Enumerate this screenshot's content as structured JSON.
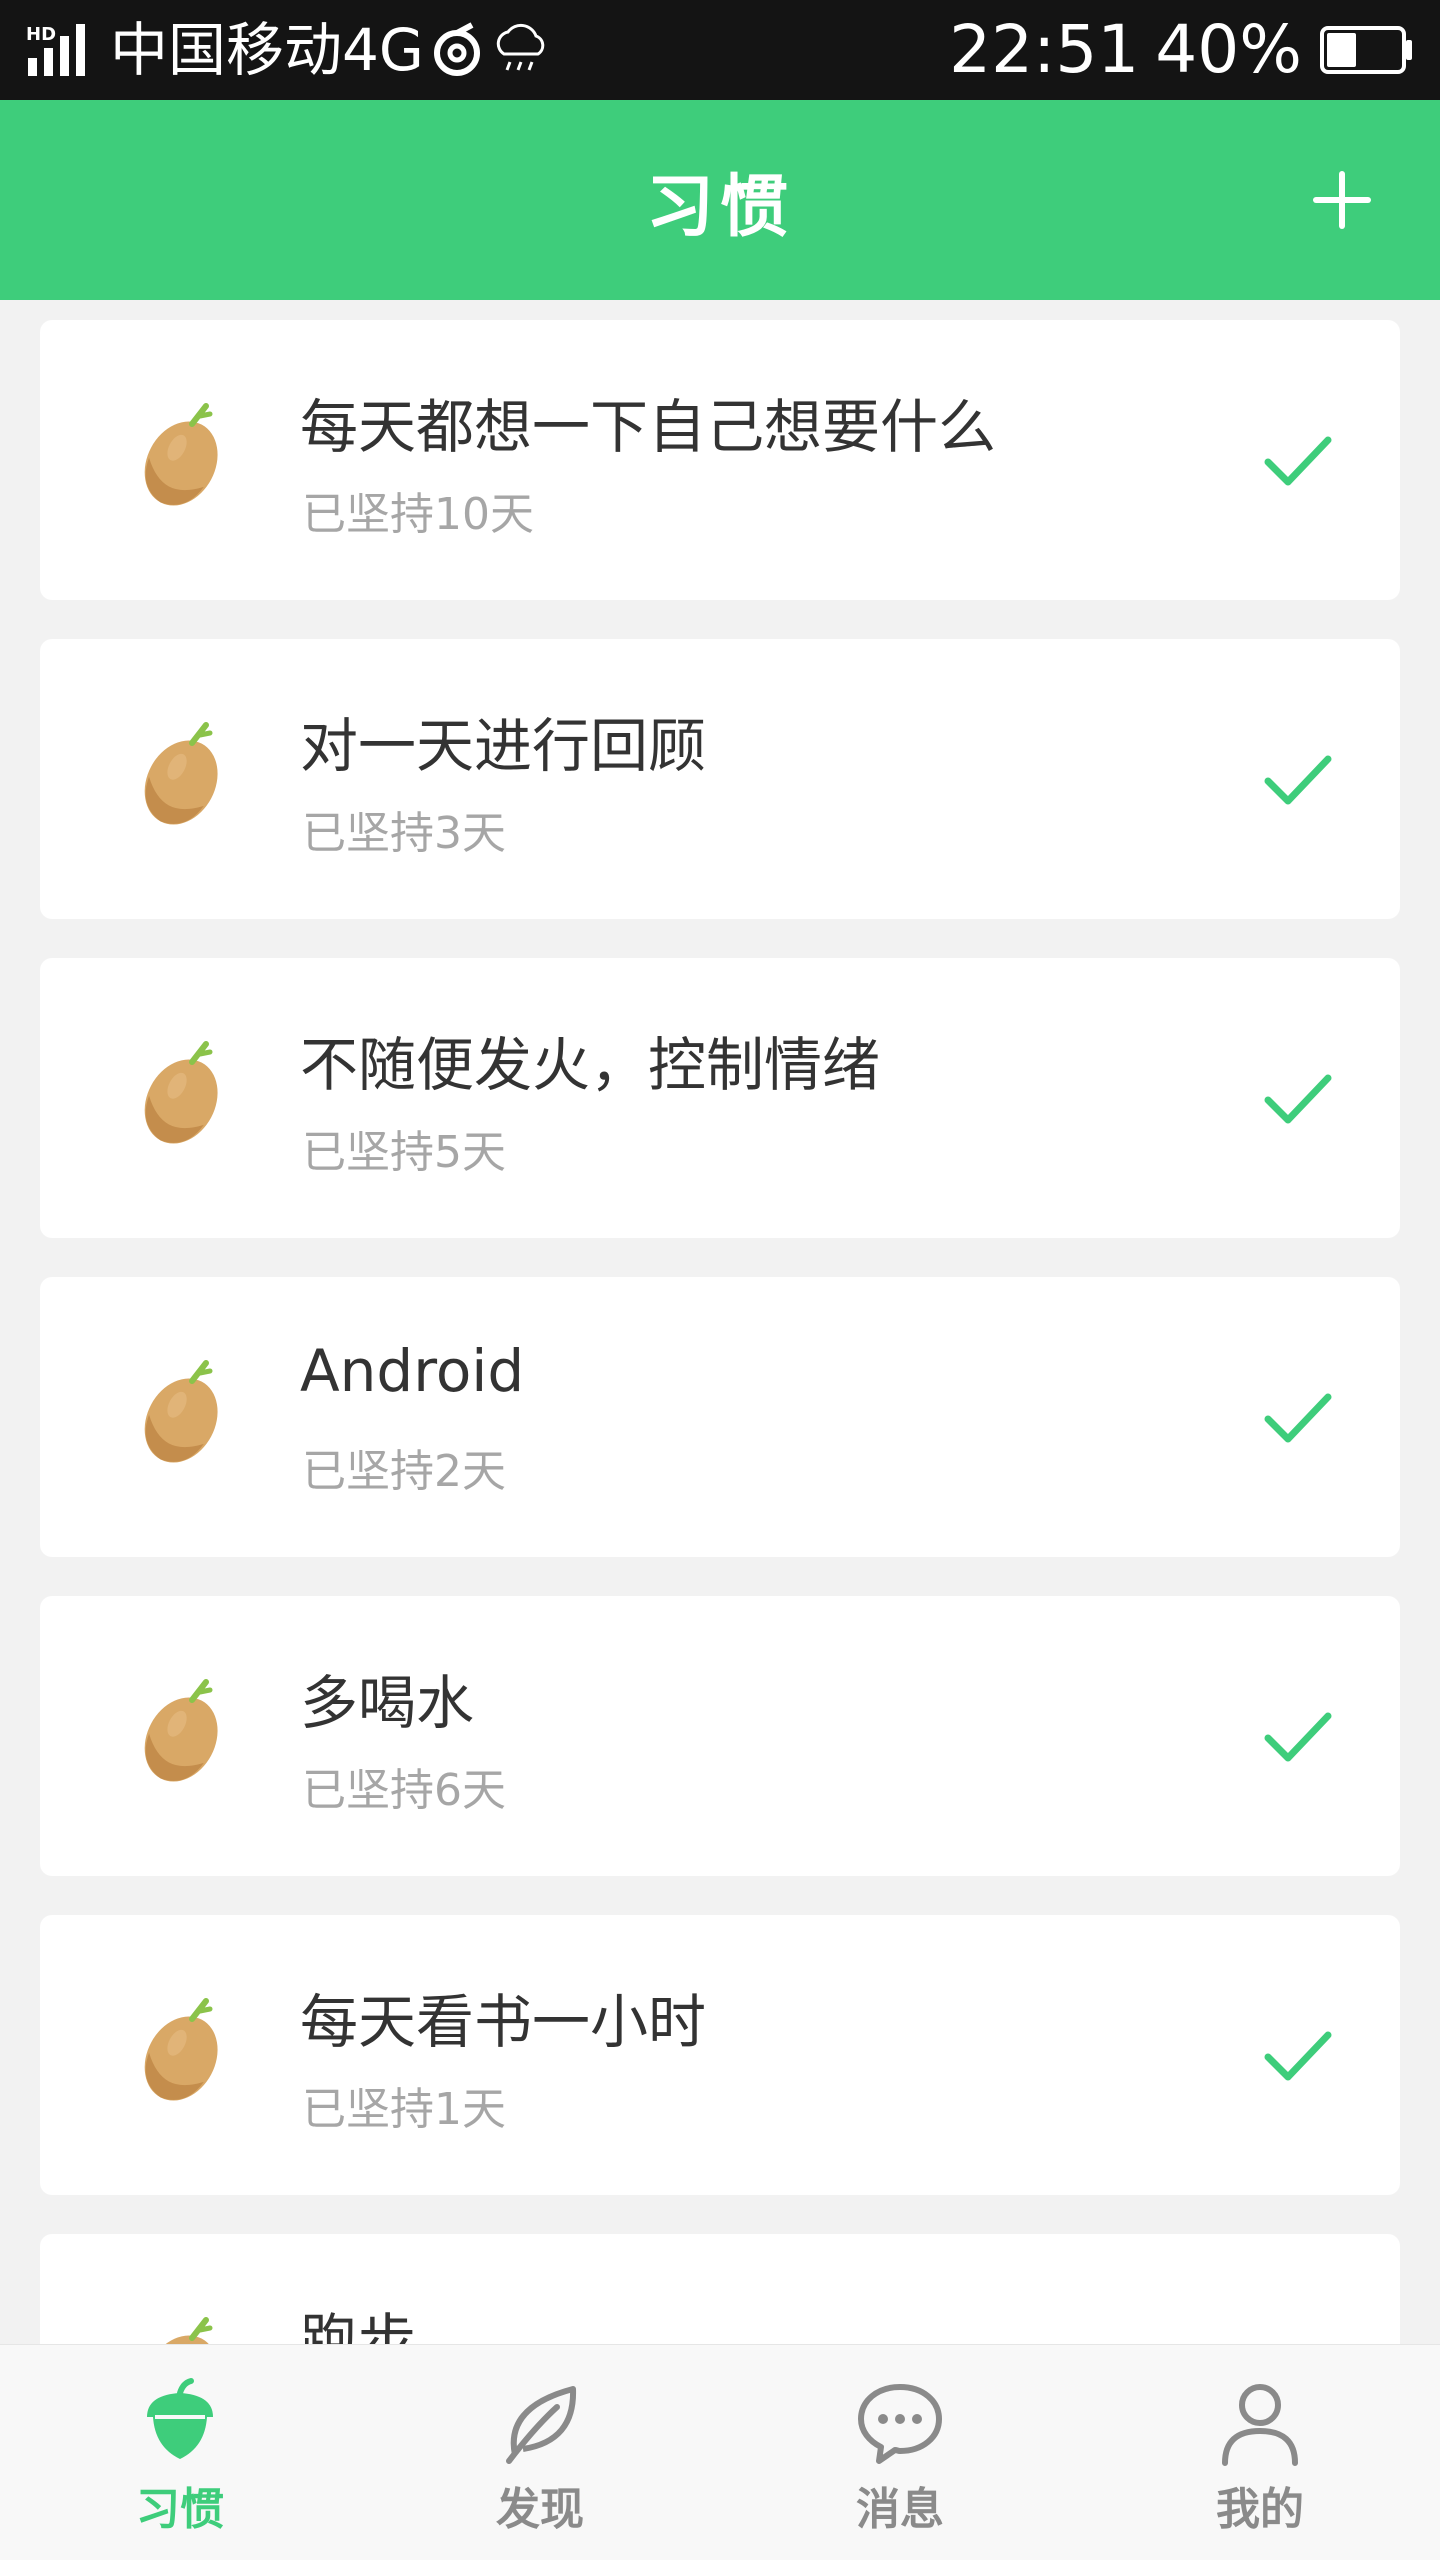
{
  "status_bar": {
    "network_badge": "HD",
    "carrier": "中国移动4G",
    "time": "22:51",
    "battery": "40%",
    "battery_level": 0.4
  },
  "header": {
    "title": "习惯",
    "add_icon": "plus-icon"
  },
  "colors": {
    "accent": "#3ecd7b",
    "status_bar": "#141414",
    "background": "#f2f2f2",
    "card": "#ffffff",
    "title_text": "#333333",
    "secondary_text": "#a6a6a6",
    "inactive_tab": "#8a8a8a",
    "acorn": "#d9a866"
  },
  "habits": [
    {
      "name": "每天都想一下自己想要什么",
      "streak": "已坚持10天"
    },
    {
      "name": "对一天进行回顾",
      "streak": "已坚持3天"
    },
    {
      "name": "不随便发火，控制情绪",
      "streak": "已坚持5天"
    },
    {
      "name": "Android",
      "streak": "已坚持2天"
    },
    {
      "name": "多喝水",
      "streak": "已坚持6天"
    },
    {
      "name": "每天看书一小时",
      "streak": "已坚持1天"
    },
    {
      "name": "跑步",
      "streak": ""
    }
  ],
  "tabs": [
    {
      "label": "习惯",
      "icon": "acorn-icon",
      "active": true
    },
    {
      "label": "发现",
      "icon": "leaf-icon",
      "active": false
    },
    {
      "label": "消息",
      "icon": "chat-bubble-icon",
      "active": false
    },
    {
      "label": "我的",
      "icon": "person-icon",
      "active": false
    }
  ]
}
